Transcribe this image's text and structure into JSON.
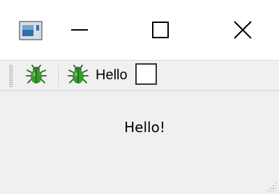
{
  "titlebar": {
    "app_icon": "window-app-icon",
    "minimize_icon": "minimize-icon",
    "maximize_icon": "maximize-icon",
    "close_icon": "close-icon"
  },
  "toolbar": {
    "bug_icon": "bug-icon",
    "button_label": "Hello",
    "checkbox_checked": false
  },
  "central": {
    "label": "Hello!"
  },
  "colors": {
    "bug_green": "#3a9a2e",
    "window_bg": "#f0f0f0",
    "titlebar_bg": "#ffffff"
  }
}
